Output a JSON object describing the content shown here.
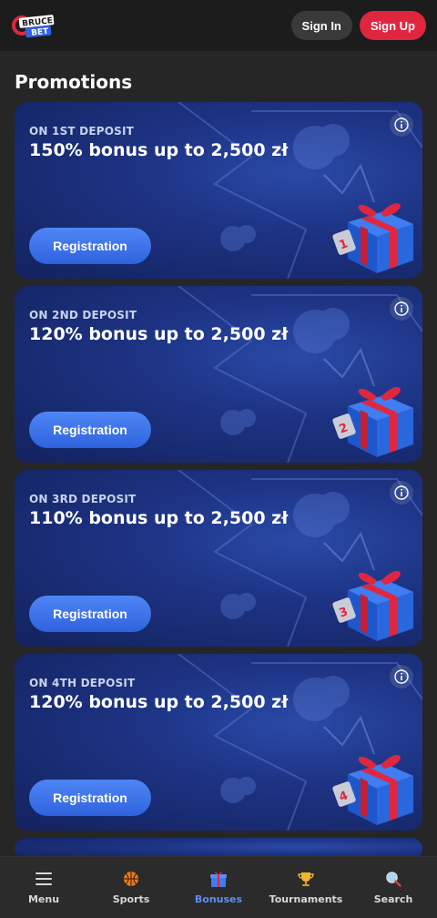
{
  "header": {
    "logo_text_top": "BRUCE",
    "logo_text_bottom": "BET",
    "signin_label": "Sign In",
    "signup_label": "Sign Up"
  },
  "page_title": "Promotions",
  "promotions": [
    {
      "label": "ON 1ST DEPOSIT",
      "title": "150% bonus up to 2,500 zł",
      "button": "Registration",
      "gift_number": "1"
    },
    {
      "label": "ON 2ND DEPOSIT",
      "title": "120% bonus up to 2,500 zł",
      "button": "Registration",
      "gift_number": "2"
    },
    {
      "label": "ON 3RD DEPOSIT",
      "title": "110% bonus up to 2,500 zł",
      "button": "Registration",
      "gift_number": "3"
    },
    {
      "label": "ON 4TH DEPOSIT",
      "title": "120% bonus up to 2,500 zł",
      "button": "Registration",
      "gift_number": "4"
    }
  ],
  "bottom_nav": [
    {
      "label": "Menu",
      "icon": "menu-icon"
    },
    {
      "label": "Sports",
      "icon": "basketball-icon"
    },
    {
      "label": "Bonuses",
      "icon": "gift-icon",
      "active": true
    },
    {
      "label": "Tournaments",
      "icon": "trophy-icon"
    },
    {
      "label": "Search",
      "icon": "search-icon"
    }
  ],
  "colors": {
    "accent": "#e0263f",
    "active_nav": "#5a8ef5",
    "card_bg": "#1d3383",
    "button": "#3f74ea"
  }
}
